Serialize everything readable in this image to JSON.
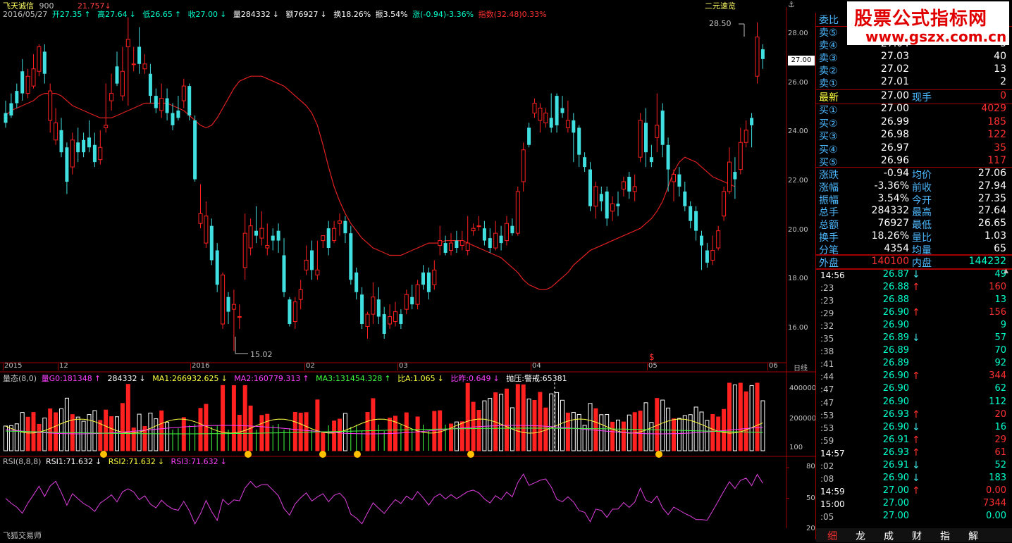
{
  "title": {
    "name": "飞天诚信",
    "code": "900",
    "extra": "21.757",
    "extra_arrow": "↓",
    "right_label": "二元速览"
  },
  "info": {
    "date": "2016/05/27",
    "open": "开27.35",
    "open_arrow": "↑",
    "high": "高27.64",
    "high_arrow": "↓",
    "low": "低26.65",
    "low_arrow": "↑",
    "close": "收27.00",
    "close_arrow": "↓",
    "vol": "量284332",
    "vol_arrow": "↓",
    "amt": "额76927",
    "amt_arrow": "↓",
    "turn": "换18.26%",
    "amp": "振3.54%",
    "chg": "涨(-0.94)-3.36%",
    "idx": "指数(32.48)0.33%"
  },
  "price_axis": [
    "28.00",
    "26.00",
    "24.00",
    "22.00",
    "20.00",
    "18.00",
    "16.00"
  ],
  "current_price_tag": "27.00",
  "annotations": {
    "high": "28.50",
    "low": "15.02",
    "marker": "$"
  },
  "date_axis": [
    "2015",
    "12",
    "2016",
    "02",
    "03",
    "04",
    "05",
    "06",
    "日线"
  ],
  "vol_indicator": {
    "name": "量态(8,0)",
    "v0": "量G0:181348",
    "v0_arrow": "↑",
    "v1": "284332",
    "v1_arrow": "↓",
    "ma1": "MA1:266932.625",
    "ma1_arrow": "↓",
    "ma2": "MA2:160779.313",
    "ma2_arrow": "↑",
    "ma3": "MA3:131454.328",
    "ma3_arrow": "↑",
    "ba": "比A:1.065",
    "ba_arrow": "↓",
    "bz": "比昨:0.649",
    "bz_arrow": "↓",
    "py": "抛压:警戒:65381"
  },
  "vol_axis": [
    "400000",
    "200000",
    "100"
  ],
  "rsi_indicator": {
    "name": "RSI(8,8,8)",
    "r1": "RSI1:71.632",
    "r1_arrow": "↓",
    "r2": "RSI2:71.632",
    "r2_arrow": "↓",
    "r3": "RSI3:71.632",
    "r3_arrow": "↓"
  },
  "rsi_axis": [
    "80",
    "50",
    "20"
  ],
  "footer": "飞狐交易师",
  "ad": {
    "line1": "股票公式指标网",
    "line2": "www.gszx.com.cn"
  },
  "quote": {
    "header": "委比",
    "sells": [
      {
        "label": "卖⑤",
        "price": "",
        "vol": ""
      },
      {
        "label": "卖④",
        "price": "27.04",
        "vol": "5"
      },
      {
        "label": "卖③",
        "price": "27.03",
        "vol": "40"
      },
      {
        "label": "卖②",
        "price": "27.02",
        "vol": "13"
      },
      {
        "label": "卖①",
        "price": "27.01",
        "vol": "2"
      }
    ],
    "latest": {
      "label": "最新",
      "price": "27.00",
      "label2": "现手",
      "vol": "0"
    },
    "buys": [
      {
        "label": "买①",
        "price": "27.00",
        "vol": "4029"
      },
      {
        "label": "买②",
        "price": "26.99",
        "vol": "185"
      },
      {
        "label": "买③",
        "price": "26.98",
        "vol": "122"
      },
      {
        "label": "买④",
        "price": "26.97",
        "vol": "35"
      },
      {
        "label": "买⑤",
        "price": "26.96",
        "vol": "117"
      }
    ],
    "stats": [
      {
        "l1": "涨跌",
        "v1": "-0.94",
        "l2": "均价",
        "v2": "27.06"
      },
      {
        "l1": "涨幅",
        "v1": "-3.36%",
        "l2": "前收",
        "v2": "27.94"
      },
      {
        "l1": "振幅",
        "v1": "3.54%",
        "l2": "今开",
        "v2": "27.35"
      },
      {
        "l1": "总手",
        "v1": "284332",
        "l2": "最高",
        "v2": "27.64"
      },
      {
        "l1": "总额",
        "v1": "76927",
        "l2": "最低",
        "v2": "26.65"
      },
      {
        "l1": "换手",
        "v1": "18.26%",
        "l2": "量比",
        "v2": "1.03"
      },
      {
        "l1": "分笔",
        "v1": "4354",
        "l2": "均量",
        "v2": "65"
      }
    ],
    "outer": {
      "l1": "外盘",
      "v1": "140100",
      "l2": "内盘",
      "v2": "144232"
    },
    "ticks": [
      {
        "t": "14:56",
        "p": "26.87",
        "a": "↓",
        "v": "49"
      },
      {
        "t": ":23",
        "p": "26.88",
        "a": "↑",
        "v": "160"
      },
      {
        "t": ":23",
        "p": "26.88",
        "a": "",
        "v": "13"
      },
      {
        "t": ":29",
        "p": "26.90",
        "a": "↑",
        "v": "156"
      },
      {
        "t": ":32",
        "p": "26.90",
        "a": "",
        "v": "9"
      },
      {
        "t": ":35",
        "p": "26.89",
        "a": "↓",
        "v": "57"
      },
      {
        "t": ":38",
        "p": "26.89",
        "a": "",
        "v": "70"
      },
      {
        "t": ":41",
        "p": "26.89",
        "a": "",
        "v": "92"
      },
      {
        "t": ":44",
        "p": "26.90",
        "a": "↑",
        "v": "344"
      },
      {
        "t": ":47",
        "p": "26.90",
        "a": "",
        "v": "62"
      },
      {
        "t": ":47",
        "p": "26.90",
        "a": "",
        "v": "112"
      },
      {
        "t": ":53",
        "p": "26.93",
        "a": "↑",
        "v": "20"
      },
      {
        "t": ":53",
        "p": "26.90",
        "a": "↓",
        "v": "16"
      },
      {
        "t": ":59",
        "p": "26.91",
        "a": "↑",
        "v": "29"
      },
      {
        "t": "14:57",
        "p": "26.93",
        "a": "↑",
        "v": "61"
      },
      {
        "t": ":02",
        "p": "26.91",
        "a": "↓",
        "v": "52"
      },
      {
        "t": ":08",
        "p": "26.90",
        "a": "↓",
        "v": "183"
      },
      {
        "t": "14:59",
        "p": "27.00",
        "a": "↑",
        "v": "0.00"
      },
      {
        "t": "15:00",
        "p": "27.00",
        "a": "",
        "v": "7344"
      },
      {
        "t": ":05",
        "p": "27.00",
        "a": "",
        "v": "0.00"
      }
    ],
    "tabs": [
      "细",
      "龙",
      "成",
      "财",
      "指",
      "解"
    ]
  },
  "colors": {
    "up": "#ff2020",
    "down": "#40e0e0",
    "ma": "#e02020",
    "rsi": "#e040e0"
  },
  "chart_data": {
    "type": "candlestick",
    "price_range": [
      15.0,
      29.0
    ],
    "candles": [
      [
        24.8,
        24.4,
        25.3,
        24.2
      ],
      [
        25.2,
        24.7,
        25.6,
        24.6
      ],
      [
        25.7,
        25.2,
        26.0,
        25.0
      ],
      [
        26.5,
        25.6,
        27.0,
        25.3
      ],
      [
        25.6,
        26.3,
        26.6,
        25.4
      ],
      [
        25.9,
        26.6,
        27.2,
        25.8
      ],
      [
        26.5,
        27.5,
        27.6,
        26.3
      ],
      [
        27.3,
        26.4,
        27.6,
        26.0
      ],
      [
        24.5,
        25.7,
        26.0,
        24.0
      ],
      [
        23.7,
        24.4,
        25.0,
        23.5
      ],
      [
        24.1,
        23.2,
        24.6,
        23.0
      ],
      [
        23.4,
        22.0,
        23.6,
        21.5
      ],
      [
        22.6,
        23.7,
        24.0,
        22.3
      ],
      [
        23.6,
        23.2,
        24.2,
        22.8
      ],
      [
        23.7,
        23.2,
        24.0,
        23.0
      ],
      [
        23.8,
        23.4,
        24.5,
        23.2
      ],
      [
        23.5,
        22.8,
        24.0,
        22.6
      ],
      [
        22.9,
        23.4,
        24.1,
        22.7
      ],
      [
        24.2,
        24.3,
        26.0,
        24.0
      ],
      [
        25.3,
        25.6,
        26.4,
        24.9
      ],
      [
        26.7,
        26.0,
        27.3,
        25.9
      ],
      [
        25.5,
        26.5,
        27.5,
        25.3
      ],
      [
        27.5,
        27.8,
        28.7,
        25.1
      ],
      [
        26.8,
        26.8,
        27.5,
        26.5
      ],
      [
        27.5,
        26.8,
        28.3,
        26.4
      ],
      [
        26.6,
        26.8,
        27.2,
        26.4
      ],
      [
        26.4,
        25.5,
        26.8,
        25.2
      ],
      [
        25.5,
        25.0,
        25.8,
        24.8
      ],
      [
        24.9,
        25.4,
        26.0,
        24.6
      ],
      [
        25.4,
        24.8,
        25.8,
        24.5
      ],
      [
        24.8,
        24.3,
        25.2,
        24.1
      ],
      [
        24.9,
        24.6,
        25.5,
        24.5
      ],
      [
        25.3,
        25.9,
        26.2,
        25.0
      ],
      [
        25.9,
        24.7,
        26.0,
        24.5
      ],
      [
        24.5,
        22.1,
        24.7,
        22.0
      ],
      [
        20.3,
        20.7,
        21.9,
        20.1
      ],
      [
        19.5,
        20.6,
        21.2,
        19.3
      ],
      [
        20.2,
        18.8,
        20.5,
        18.6
      ],
      [
        19.2,
        17.8,
        19.5,
        17.5
      ],
      [
        16.2,
        18.2,
        18.3,
        16.0
      ],
      [
        17.3,
        16.7,
        17.5,
        16.2
      ],
      [
        16.8,
        17.0,
        17.6,
        15.1
      ],
      [
        16.5,
        16.5,
        17.0,
        16.0
      ],
      [
        18.5,
        19.9,
        20.7,
        18.0
      ],
      [
        19.3,
        20.2,
        20.5,
        19.0
      ],
      [
        20.0,
        19.8,
        21.0,
        19.5
      ],
      [
        19.7,
        20.1,
        20.8,
        19.4
      ],
      [
        19.3,
        19.4,
        20.3,
        19.0
      ],
      [
        19.8,
        19.6,
        20.1,
        19.2
      ],
      [
        20.0,
        19.6,
        20.3,
        19.1
      ],
      [
        19.0,
        17.5,
        19.7,
        17.3
      ],
      [
        17.2,
        16.2,
        17.3,
        16.1
      ],
      [
        16.3,
        17.1,
        17.3,
        16.0
      ],
      [
        17.2,
        17.6,
        18.0,
        16.8
      ],
      [
        18.4,
        18.8,
        19.4,
        18.2
      ],
      [
        19.2,
        18.4,
        19.6,
        18.0
      ],
      [
        18.2,
        18.4,
        19.6,
        18.0
      ],
      [
        19.6,
        19.8,
        19.8,
        19.3
      ],
      [
        20.1,
        19.3,
        20.4,
        19.0
      ],
      [
        19.6,
        20.1,
        20.4,
        19.5
      ],
      [
        20.3,
        20.4,
        20.7,
        19.8
      ],
      [
        20.4,
        19.9,
        20.6,
        19.5
      ],
      [
        19.9,
        18.0,
        20.2,
        17.8
      ],
      [
        18.3,
        17.5,
        18.5,
        17.2
      ],
      [
        17.4,
        16.2,
        17.7,
        16.0
      ],
      [
        16.1,
        16.6,
        16.7,
        15.6
      ],
      [
        16.6,
        17.3,
        17.9,
        16.2
      ],
      [
        17.2,
        16.5,
        17.7,
        16.2
      ],
      [
        16.6,
        15.8,
        16.9,
        15.6
      ],
      [
        16.2,
        16.5,
        17.0,
        16.0
      ],
      [
        16.3,
        16.7,
        17.1,
        16.1
      ],
      [
        16.6,
        16.2,
        16.8,
        16.0
      ],
      [
        16.8,
        17.4,
        17.6,
        16.6
      ],
      [
        17.3,
        17.0,
        17.8,
        16.8
      ],
      [
        17.0,
        17.8,
        18.0,
        16.8
      ],
      [
        18.3,
        17.8,
        18.6,
        17.6
      ],
      [
        18.3,
        17.5,
        18.5,
        17.2
      ],
      [
        17.8,
        18.4,
        18.8,
        17.6
      ],
      [
        19.4,
        19.6,
        20.2,
        19.0
      ],
      [
        19.5,
        19.1,
        19.8,
        19.0
      ],
      [
        19.2,
        19.5,
        19.9,
        19.0
      ],
      [
        19.6,
        19.3,
        20.0,
        19.1
      ],
      [
        19.4,
        19.6,
        20.0,
        19.2
      ],
      [
        19.2,
        19.5,
        20.6,
        19.0
      ],
      [
        20.0,
        20.1,
        20.3,
        19.8
      ],
      [
        20.2,
        20.2,
        20.6,
        20.0
      ],
      [
        20.1,
        19.6,
        20.4,
        19.4
      ],
      [
        19.7,
        19.3,
        20.1,
        19.1
      ],
      [
        19.3,
        19.9,
        20.4,
        19.2
      ],
      [
        19.8,
        19.5,
        20.2,
        19.2
      ],
      [
        19.6,
        20.3,
        20.6,
        19.4
      ],
      [
        20.2,
        19.9,
        20.5,
        19.8
      ],
      [
        19.9,
        21.6,
        21.8,
        19.8
      ],
      [
        22.0,
        23.3,
        23.6,
        21.6
      ],
      [
        24.2,
        23.5,
        24.4,
        23.4
      ],
      [
        24.8,
        25.2,
        25.4,
        24.6
      ],
      [
        24.5,
        25.0,
        25.2,
        24.0
      ],
      [
        24.4,
        24.8,
        25.0,
        24.2
      ],
      [
        24.6,
        24.2,
        25.6,
        24.0
      ],
      [
        25.5,
        24.3,
        25.6,
        24.0
      ],
      [
        25.0,
        24.8,
        25.5,
        24.6
      ],
      [
        24.2,
        24.5,
        25.3,
        24.0
      ],
      [
        24.5,
        24.0,
        24.8,
        22.8
      ],
      [
        24.2,
        23.1,
        24.3,
        22.6
      ],
      [
        23.0,
        22.6,
        23.2,
        22.4
      ],
      [
        22.5,
        21.0,
        22.8,
        20.8
      ],
      [
        21.0,
        21.8,
        22.0,
        20.5
      ],
      [
        21.5,
        21.2,
        21.8,
        20.8
      ],
      [
        21.6,
        20.5,
        21.8,
        20.2
      ],
      [
        20.8,
        21.1,
        21.4,
        20.4
      ],
      [
        21.1,
        21.0,
        21.6,
        20.6
      ],
      [
        21.7,
        22.0,
        22.2,
        21.4
      ],
      [
        22.2,
        21.6,
        22.4,
        21.3
      ],
      [
        21.6,
        21.8,
        22.3,
        21.2
      ],
      [
        23.0,
        24.5,
        24.8,
        22.8
      ],
      [
        24.4,
        23.2,
        25.0,
        22.6
      ],
      [
        23.0,
        22.8,
        23.5,
        22.6
      ],
      [
        23.8,
        24.3,
        25.6,
        23.2
      ],
      [
        24.9,
        23.5,
        25.2,
        23.0
      ],
      [
        23.5,
        22.5,
        23.8,
        21.6
      ],
      [
        22.0,
        22.3,
        22.5,
        21.2
      ],
      [
        22.3,
        21.8,
        22.6,
        21.4
      ],
      [
        21.6,
        21.0,
        22.0,
        20.8
      ],
      [
        21.0,
        20.4,
        21.2,
        20.1
      ],
      [
        20.8,
        20.0,
        21.0,
        19.6
      ],
      [
        19.8,
        19.4,
        20.0,
        18.4
      ],
      [
        19.2,
        18.7,
        19.5,
        18.5
      ],
      [
        18.8,
        19.2,
        19.8,
        18.6
      ],
      [
        19.3,
        20.0,
        20.2,
        19.2
      ],
      [
        20.6,
        21.6,
        21.8,
        20.4
      ],
      [
        21.6,
        22.8,
        23.4,
        21.5
      ],
      [
        22.4,
        22.1,
        23.0,
        21.3
      ],
      [
        22.5,
        23.6,
        24.2,
        22.3
      ],
      [
        23.6,
        24.1,
        24.5,
        23.4
      ],
      [
        24.6,
        24.3,
        24.8,
        23.4
      ],
      [
        26.3,
        27.9,
        28.5,
        26.0
      ],
      [
        27.4,
        27.0,
        27.6,
        26.6
      ]
    ],
    "ma": [
      24.7,
      24.9,
      25.0,
      25.1,
      25.2,
      25.3,
      25.5,
      25.6,
      25.6,
      25.6,
      25.5,
      25.3,
      25.1,
      25.0,
      24.9,
      24.8,
      24.7,
      24.6,
      24.6,
      24.6,
      24.7,
      24.8,
      24.9,
      25.0,
      25.1,
      25.2,
      25.2,
      25.2,
      25.2,
      25.2,
      25.1,
      25.0,
      24.9,
      24.7,
      24.5,
      24.3,
      24.2,
      24.3,
      24.6,
      25.0,
      25.4,
      25.8,
      26.1,
      26.2,
      26.3,
      26.3,
      26.3,
      26.2,
      26.1,
      26.0,
      25.9,
      25.7,
      25.5,
      25.3,
      25.1,
      24.8,
      24.3,
      23.5,
      22.6,
      21.8,
      21.2,
      20.7,
      20.3,
      20.0,
      19.7,
      19.5,
      19.3,
      19.2,
      19.1,
      19.0,
      19.0,
      19.0,
      19.1,
      19.2,
      19.3,
      19.4,
      19.5,
      19.5,
      19.5,
      19.6,
      19.6,
      19.6,
      19.6,
      19.5,
      19.4,
      19.3,
      19.2,
      19.1,
      19.0,
      18.9,
      18.7,
      18.5,
      18.3,
      18.0,
      17.8,
      17.7,
      17.6,
      17.6,
      17.7,
      17.9,
      18.1,
      18.3,
      18.6,
      18.8,
      19.0,
      19.2,
      19.3,
      19.4,
      19.5,
      19.6,
      19.7,
      19.8,
      19.9,
      20.0,
      20.1,
      20.3,
      20.5,
      20.8,
      21.2,
      21.8,
      22.4,
      22.8,
      23.0,
      22.9,
      22.8,
      22.6,
      22.4,
      22.2,
      22.1,
      22.0,
      21.9,
      21.8
    ]
  }
}
